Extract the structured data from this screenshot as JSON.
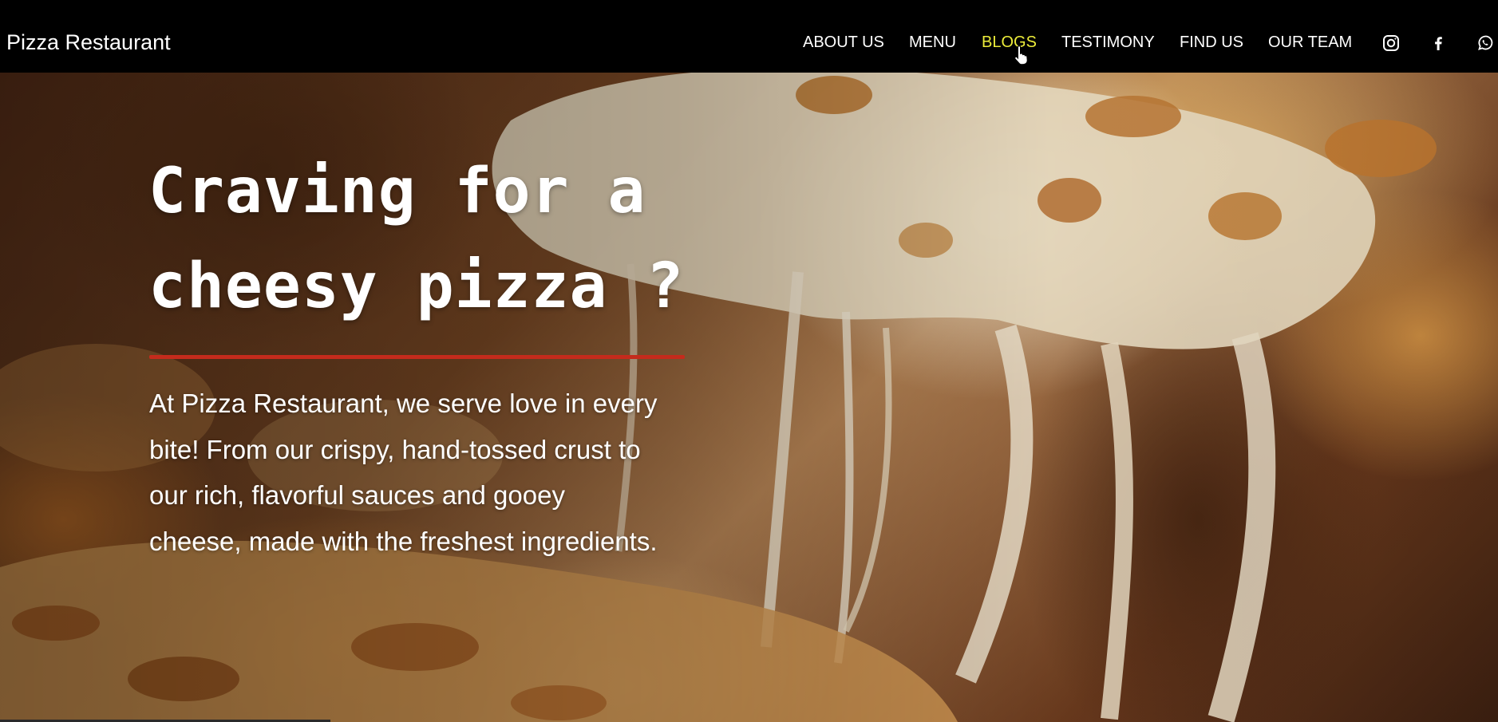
{
  "navbar": {
    "brand": "Pizza Restaurant",
    "links": [
      {
        "label": "ABOUT US",
        "active": false
      },
      {
        "label": "MENU",
        "active": false
      },
      {
        "label": "BLOGS",
        "active": true
      },
      {
        "label": "TESTIMONY",
        "active": false
      },
      {
        "label": "FIND US",
        "active": false
      },
      {
        "label": "OUR TEAM",
        "active": false
      }
    ],
    "social_icons": [
      "instagram-icon",
      "facebook-icon",
      "whatsapp-icon"
    ]
  },
  "hero": {
    "title_line1": "Craving for a",
    "title_line2": "cheesy pizza ?",
    "description": "At Pizza Restaurant, we serve love in every bite! From our crispy, hand-tossed crust to our rich, flavorful sauces and gooey cheese, made with the freshest ingredients."
  },
  "colors": {
    "nav_background": "#000000",
    "nav_text": "#ffffff",
    "nav_active": "#ecec3a",
    "accent_line": "#c42b1c",
    "hero_text": "#ffffff"
  }
}
